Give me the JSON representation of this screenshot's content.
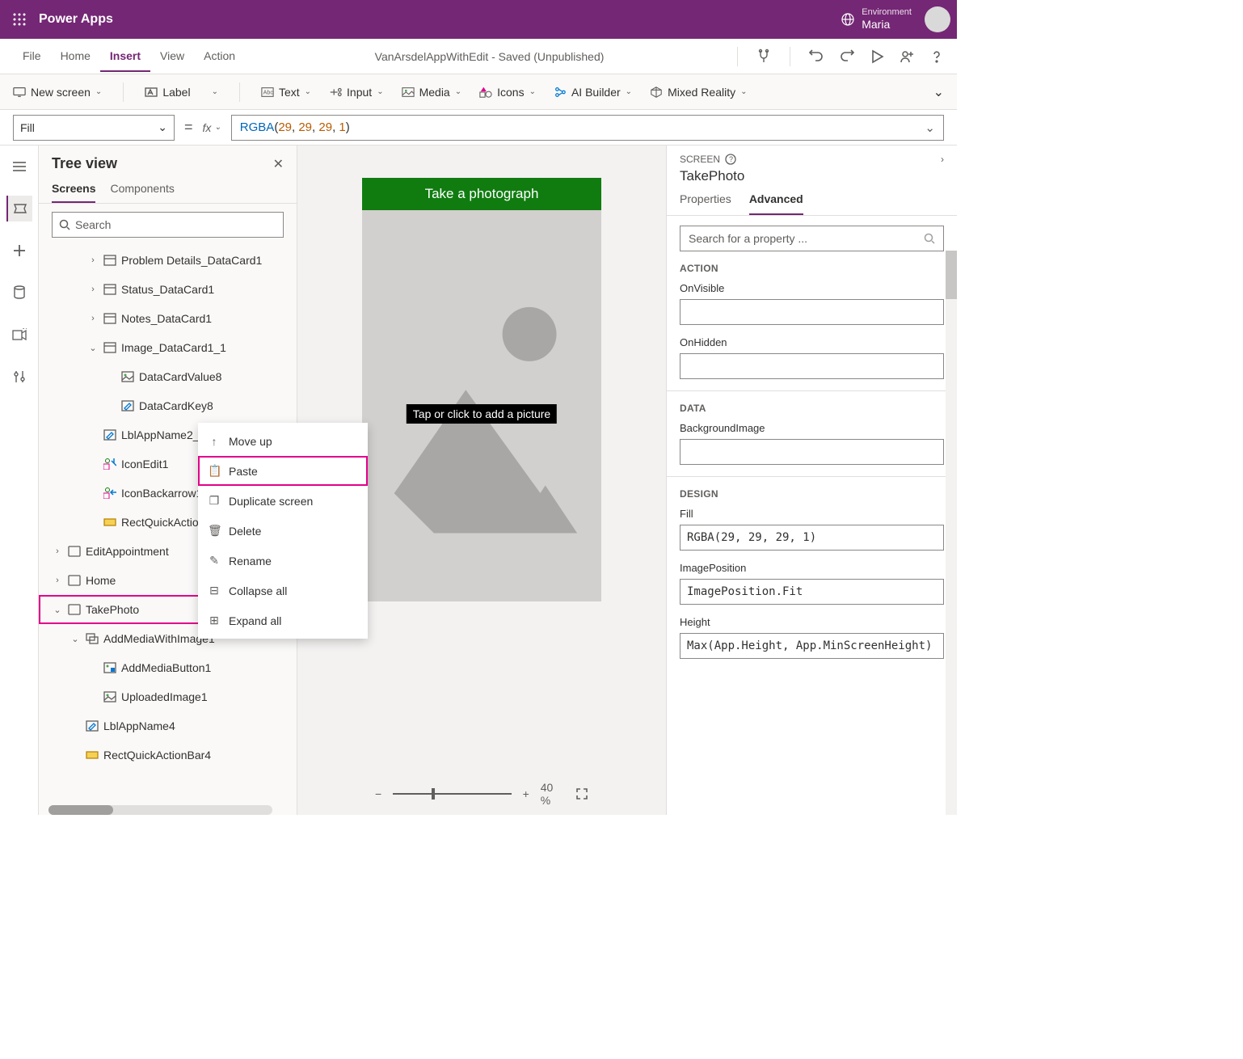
{
  "topbar": {
    "brand": "Power Apps",
    "env_label": "Environment",
    "env_name": "Maria"
  },
  "menubar": {
    "items": [
      "File",
      "Home",
      "Insert",
      "View",
      "Action"
    ],
    "active": 2,
    "doc_title": "VanArsdelAppWithEdit - Saved (Unpublished)"
  },
  "ribbon": {
    "items": [
      {
        "label": "New screen"
      },
      {
        "label": "Label"
      },
      {
        "label": "Text"
      },
      {
        "label": "Input"
      },
      {
        "label": "Media"
      },
      {
        "label": "Icons"
      },
      {
        "label": "AI Builder"
      },
      {
        "label": "Mixed Reality"
      }
    ]
  },
  "formula": {
    "property": "Fill",
    "fn": "RGBA",
    "args": [
      "29",
      "29",
      "29",
      "1"
    ]
  },
  "tree": {
    "title": "Tree view",
    "tabs": [
      "Screens",
      "Components"
    ],
    "active_tab": 0,
    "search_placeholder": "Search",
    "nodes": [
      {
        "indent": 2,
        "exp": ">",
        "icon": "card",
        "label": "Problem Details_DataCard1"
      },
      {
        "indent": 2,
        "exp": ">",
        "icon": "card",
        "label": "Status_DataCard1"
      },
      {
        "indent": 2,
        "exp": ">",
        "icon": "card",
        "label": "Notes_DataCard1"
      },
      {
        "indent": 2,
        "exp": "v",
        "icon": "card",
        "label": "Image_DataCard1_1"
      },
      {
        "indent": 3,
        "exp": "",
        "icon": "img",
        "label": "DataCardValue8"
      },
      {
        "indent": 3,
        "exp": "",
        "icon": "edit",
        "label": "DataCardKey8"
      },
      {
        "indent": 2,
        "exp": "",
        "icon": "edit",
        "label": "LblAppName2_1"
      },
      {
        "indent": 2,
        "exp": "",
        "icon": "iconedit",
        "label": "IconEdit1"
      },
      {
        "indent": 2,
        "exp": "",
        "icon": "iconback",
        "label": "IconBackarrow1_1"
      },
      {
        "indent": 2,
        "exp": "",
        "icon": "rect",
        "label": "RectQuickActionBar2"
      },
      {
        "indent": 0,
        "exp": ">",
        "icon": "screen",
        "label": "EditAppointment"
      },
      {
        "indent": 0,
        "exp": ">",
        "icon": "screen",
        "label": "Home"
      },
      {
        "indent": 0,
        "exp": "v",
        "icon": "screen",
        "label": "TakePhoto",
        "sel": true
      },
      {
        "indent": 1,
        "exp": "v",
        "icon": "group",
        "label": "AddMediaWithImage1"
      },
      {
        "indent": 2,
        "exp": "",
        "icon": "media",
        "label": "AddMediaButton1"
      },
      {
        "indent": 2,
        "exp": "",
        "icon": "img",
        "label": "UploadedImage1"
      },
      {
        "indent": 1,
        "exp": "",
        "icon": "edit",
        "label": "LblAppName4"
      },
      {
        "indent": 1,
        "exp": "",
        "icon": "rect",
        "label": "RectQuickActionBar4"
      }
    ]
  },
  "ctx": {
    "items": [
      {
        "icon": "↑",
        "label": "Move up"
      },
      {
        "icon": "📋",
        "label": "Paste",
        "hl": true
      },
      {
        "icon": "❐",
        "label": "Duplicate screen"
      },
      {
        "icon": "🗑",
        "label": "Delete"
      },
      {
        "icon": "✎",
        "label": "Rename"
      },
      {
        "icon": "⊟",
        "label": "Collapse all"
      },
      {
        "icon": "⊞",
        "label": "Expand all"
      }
    ]
  },
  "canvas": {
    "header": "Take a photograph",
    "tap_label": "Tap or click to add a picture",
    "zoom": "40 %"
  },
  "rpanel": {
    "kind": "SCREEN",
    "title": "TakePhoto",
    "tabs": [
      "Properties",
      "Advanced"
    ],
    "active_tab": 1,
    "search_placeholder": "Search for a property ...",
    "sections": {
      "action": {
        "label": "ACTION",
        "fields": [
          {
            "label": "OnVisible",
            "value": ""
          },
          {
            "label": "OnHidden",
            "value": ""
          }
        ]
      },
      "data": {
        "label": "DATA",
        "fields": [
          {
            "label": "BackgroundImage",
            "value": ""
          }
        ]
      },
      "design": {
        "label": "DESIGN",
        "fields": [
          {
            "label": "Fill",
            "value": "RGBA(29, 29, 29, 1)"
          },
          {
            "label": "ImagePosition",
            "value": "ImagePosition.Fit"
          },
          {
            "label": "Height",
            "value": "Max(App.Height, App.MinScreenHeight)"
          }
        ]
      }
    }
  }
}
